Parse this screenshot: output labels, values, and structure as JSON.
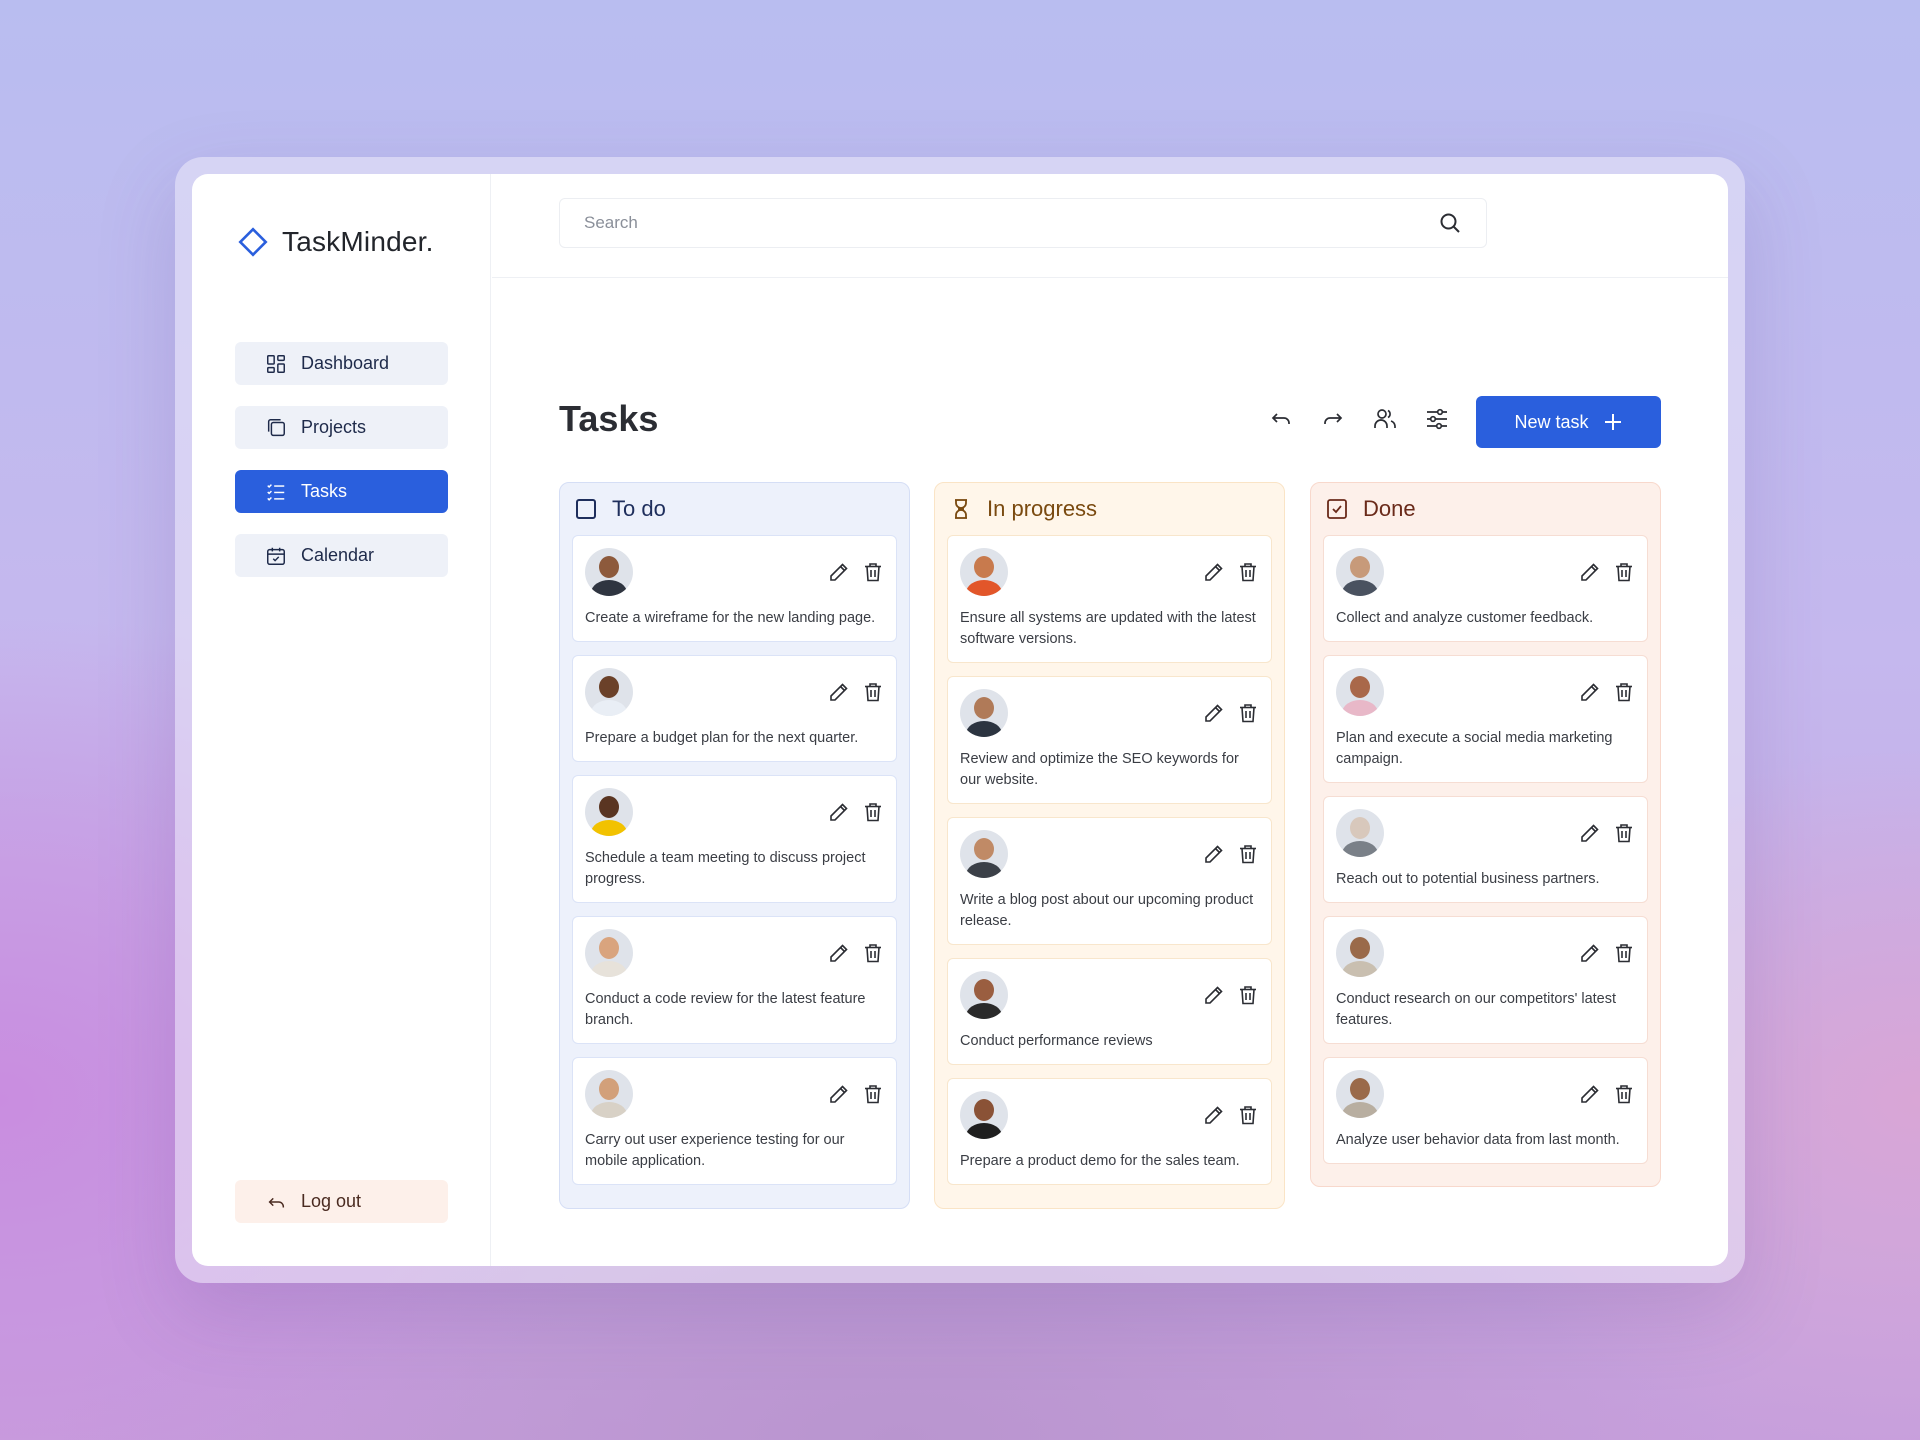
{
  "app": {
    "logo_text": "TaskMinder."
  },
  "sidebar": {
    "items": [
      {
        "label": "Dashboard",
        "icon": "dashboard-icon",
        "active": false
      },
      {
        "label": "Projects",
        "icon": "projects-icon",
        "active": false
      },
      {
        "label": "Tasks",
        "icon": "tasks-icon",
        "active": true
      },
      {
        "label": "Calendar",
        "icon": "calendar-icon",
        "active": false
      }
    ],
    "logout_label": "Log out"
  },
  "search": {
    "placeholder": "Search",
    "value": ""
  },
  "header": {
    "notification_dot_color": "#e5483b"
  },
  "page": {
    "title": "Tasks",
    "new_task_label": "New task",
    "accent_color": "#2a5fdd"
  },
  "columns": [
    {
      "title": "To do",
      "icon": "checkbox-empty-icon",
      "cards": [
        {
          "text": "Create a wireframe for the new landing page."
        },
        {
          "text": "Prepare a budget plan for the next quarter."
        },
        {
          "text": "Schedule a team meeting to discuss project progress."
        },
        {
          "text": "Conduct a code review for the latest feature branch."
        },
        {
          "text": "Carry out user experience testing for our mobile application."
        }
      ]
    },
    {
      "title": "In progress",
      "icon": "hourglass-icon",
      "cards": [
        {
          "text": "Ensure all systems are updated with the latest software versions."
        },
        {
          "text": "Review and optimize the SEO keywords for our website."
        },
        {
          "text": "Write a blog post about our upcoming product release."
        },
        {
          "text": "Conduct performance reviews"
        },
        {
          "text": "Prepare a product demo for the sales team."
        }
      ]
    },
    {
      "title": "Done",
      "icon": "checkbox-checked-icon",
      "cards": [
        {
          "text": "Collect and analyze customer feedback."
        },
        {
          "text": "Plan and execute a social media marketing campaign."
        },
        {
          "text": "Reach out to potential business partners."
        },
        {
          "text": "Conduct research on our competitors' latest features."
        },
        {
          "text": "Analyze user behavior data from last month."
        }
      ]
    }
  ]
}
